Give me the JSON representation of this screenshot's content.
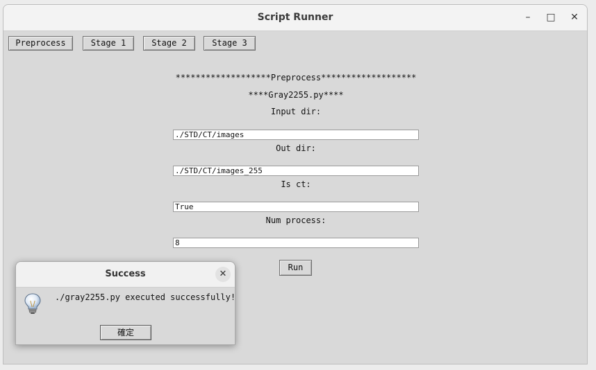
{
  "window": {
    "title": "Script Runner",
    "minimize_glyph": "–",
    "maximize_glyph": "□",
    "close_glyph": "✕"
  },
  "tabs": [
    {
      "label": "Preprocess"
    },
    {
      "label": "Stage 1"
    },
    {
      "label": "Stage 2"
    },
    {
      "label": "Stage 3"
    }
  ],
  "form": {
    "section_header": "*******************Preprocess*******************",
    "script_name": "****Gray2255.py****",
    "fields": [
      {
        "label": "Input dir:",
        "value": "./STD/CT/images"
      },
      {
        "label": "Out dir:",
        "value": "./STD/CT/images_255"
      },
      {
        "label": "Is ct:",
        "value": "True"
      },
      {
        "label": "Num process:",
        "value": "8"
      }
    ],
    "run_label": "Run"
  },
  "dialog": {
    "title": "Success",
    "close_glyph": "✕",
    "message": "./gray2255.py executed successfully!",
    "ok_label": "確定",
    "icon": "lightbulb-info-icon"
  }
}
